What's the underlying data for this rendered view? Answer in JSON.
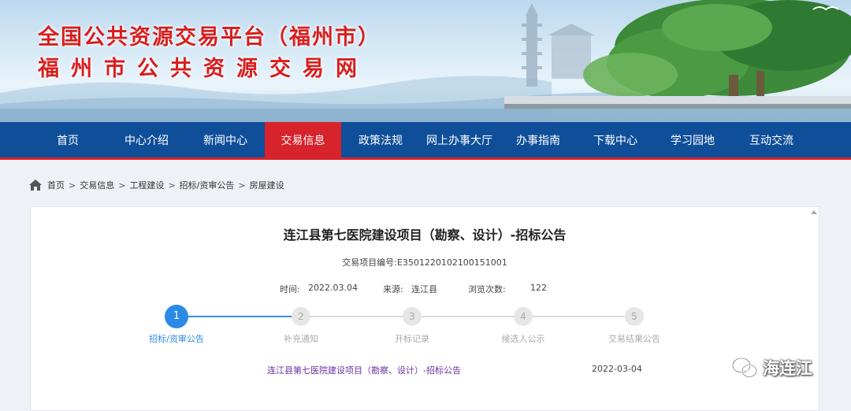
{
  "banner": {
    "title_line1": "全国公共资源交易平台（福州市）",
    "title_line2": "福州市公共资源交易网"
  },
  "nav": {
    "items": [
      {
        "label": "首页"
      },
      {
        "label": "中心介绍"
      },
      {
        "label": "新闻中心"
      },
      {
        "label": "交易信息",
        "active": true
      },
      {
        "label": "政策法规"
      },
      {
        "label": "网上办事大厅"
      },
      {
        "label": "办事指南"
      },
      {
        "label": "下载中心"
      },
      {
        "label": "学习园地"
      },
      {
        "label": "互动交流"
      }
    ]
  },
  "breadcrumb": {
    "icon": "home-icon",
    "items": [
      "首页",
      "交易信息",
      "工程建设",
      "招标/资审公告",
      "房屋建设"
    ],
    "separator": ">"
  },
  "article": {
    "title": "连江县第七医院建设项目（勘察、设计）-招标公告",
    "code": "交易项目编号:E3501220102100151001",
    "time_label": "时间:",
    "time_value": "2022.03.04",
    "source_label": "来源:",
    "source_value": "连江县",
    "views_label": "浏览次数:",
    "views_value": "122"
  },
  "steps": [
    {
      "num": "1",
      "label": "招标/资审公告",
      "active": true
    },
    {
      "num": "2",
      "label": "补充通知"
    },
    {
      "num": "3",
      "label": "开标记录"
    },
    {
      "num": "4",
      "label": "候选人公示"
    },
    {
      "num": "5",
      "label": "交易结果公告"
    }
  ],
  "notice": {
    "link": "连江县第七医院建设项目（勘察、设计）-招标公告",
    "date": "2022-03-04"
  },
  "watermark": {
    "icon": "wechat-icon",
    "text": "海连江"
  },
  "colors": {
    "nav_bg": "#0f4f9a",
    "nav_active": "#d7232b",
    "title_red": "#d81e1e",
    "step_active": "#2b8ae6",
    "link_purple": "#6a2fa0"
  }
}
